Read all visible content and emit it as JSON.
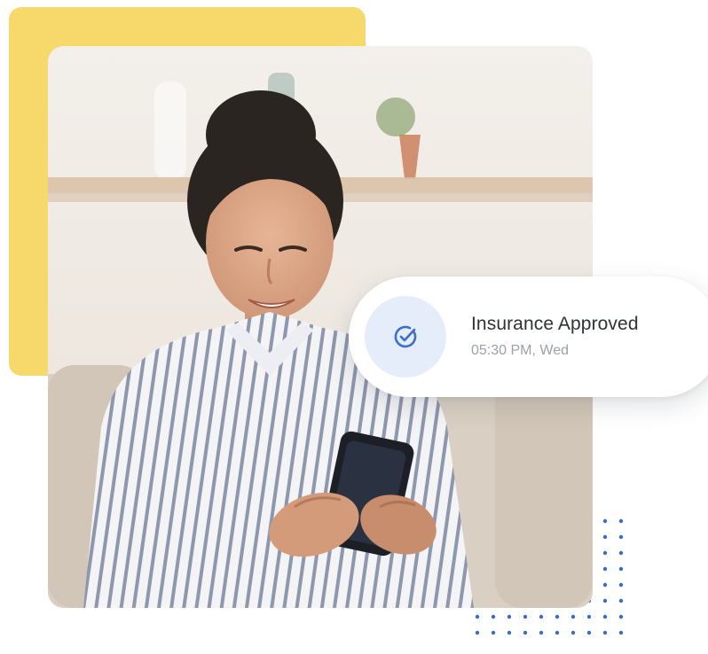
{
  "colors": {
    "accent_yellow": "#f6d96a",
    "check_blue": "#3b6fc9",
    "badge_bg": "#e4edf9",
    "dot_blue": "#3a6cc4"
  },
  "notification": {
    "icon": "check-circle-icon",
    "title": "Insurance Approved",
    "time": "05:30 PM, Wed"
  }
}
